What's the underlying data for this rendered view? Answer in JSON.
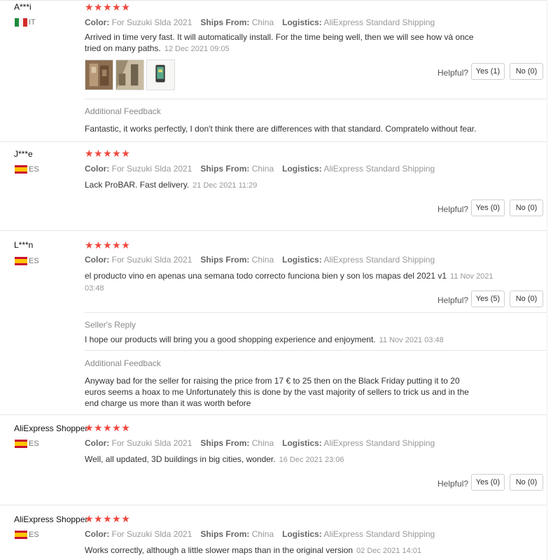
{
  "labels": {
    "color": "Color:",
    "ships_from": "Ships From:",
    "logistics": "Logistics:",
    "helpful": "Helpful?",
    "no": "No (0)",
    "additional_feedback": "Additional Feedback",
    "sellers_reply": "Seller's Reply"
  },
  "stars": "★★★★★",
  "reviews": [
    {
      "user": "A***i",
      "country": "IT",
      "color": "For Suzuki Slda 2021",
      "ships_from": "China",
      "logistics": "AliExpress Standard Shipping",
      "text": "Arrived in time very fast. It will automatically install. For the time being well, then we will see how và once tried on many paths.",
      "date": "12 Dec 2021 09:05",
      "yes": "Yes (1)",
      "additional_feedback": "Fantastic, it works perfectly, I don't think there are differences with that standard. Compratelo without fear."
    },
    {
      "user": "J***e",
      "country": "ES",
      "color": "For Suzuki Slda 2021",
      "ships_from": "China",
      "logistics": "AliExpress Standard Shipping",
      "text": "Lack ProBAR. Fast delivery.",
      "date": "21 Dec 2021 11:29",
      "yes": "Yes (0)"
    },
    {
      "user": "L***n",
      "country": "ES",
      "color": "For Suzuki Slda 2021",
      "ships_from": "China",
      "logistics": "AliExpress Standard Shipping",
      "text": "el producto vino en apenas una semana todo correcto funciona bien y son los mapas del 2021 v1",
      "date": "11 Nov 2021 03:48",
      "yes": "Yes (5)",
      "seller_reply": "I hope our products will bring you a good shopping experience and enjoyment.",
      "seller_reply_date": "11 Nov 2021 03:48",
      "additional_feedback": "Anyway bad for the seller for raising the price from 17 € to 25 then on the Black Friday putting it to 20 euros seems a hoax to me Unfortunately this is done by the vast majority of sellers to trick us and in the end charge us more than it was worth before"
    },
    {
      "user": "AliExpress Shopper",
      "country": "ES",
      "color": "For Suzuki Slda 2021",
      "ships_from": "China",
      "logistics": "AliExpress Standard Shipping",
      "text": "Well, all updated, 3D buildings in big cities, wonder.",
      "date": "16 Dec 2021 23:06",
      "yes": "Yes (0)"
    },
    {
      "user": "AliExpress Shopper",
      "country": "ES",
      "color": "For Suzuki Slda 2021",
      "ships_from": "China",
      "logistics": "AliExpress Standard Shipping",
      "text": "Works correctly, although a little slower maps than in the original version",
      "date": "02 Dec 2021 14:01"
    }
  ],
  "colors": {
    "star": "#f0483e",
    "flag_it": [
      "#1f8a3b",
      "#f4f4f4",
      "#d52b2b"
    ],
    "flag_es": [
      "#c8102e",
      "#ffc400"
    ]
  }
}
